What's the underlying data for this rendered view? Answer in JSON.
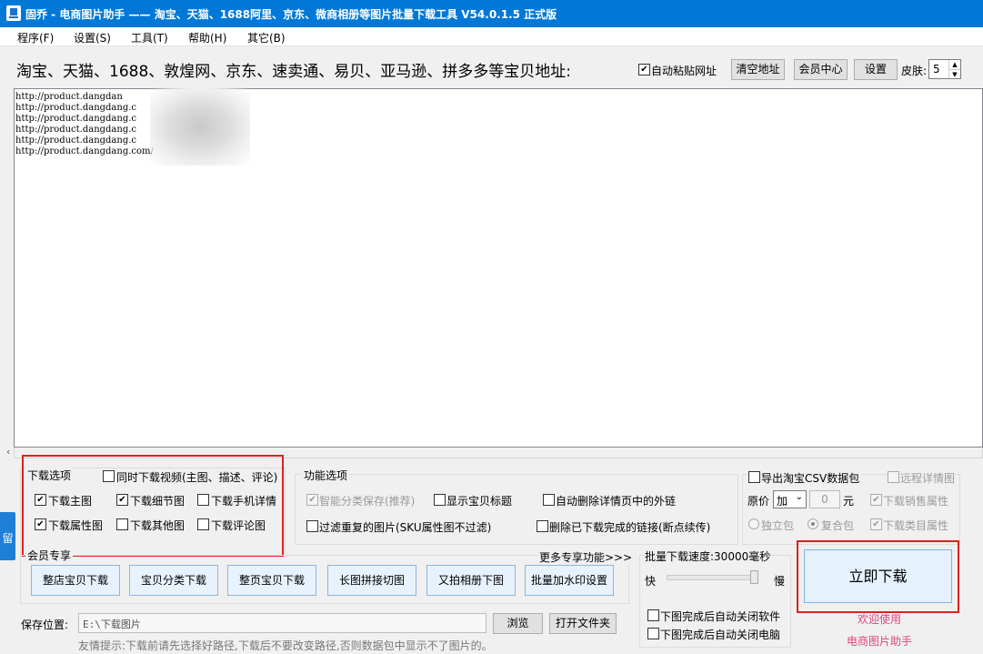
{
  "window": {
    "title": "固乔 - 电商图片助手 —— 淘宝、天猫、1688阿里、京东、微商相册等图片批量下载工具 V54.0.1.5 正式版"
  },
  "menu": [
    "程序(F)",
    "设置(S)",
    "工具(T)",
    "帮助(H)",
    "其它(B)"
  ],
  "toolbar": {
    "url_label": "淘宝、天猫、1688、敦煌网、京东、速卖通、易贝、亚马逊、拼多多等宝贝地址:",
    "auto_paste_label": "自动粘贴网址",
    "auto_paste_checked": true,
    "clear_button": "清空地址",
    "member_button": "会员中心",
    "settings_button": "设置",
    "skin_label": "皮肤:",
    "skin_value": "5"
  },
  "url_list": [
    "http://product.dangdan",
    "http://product.dangdang.c",
    "http://product.dangdang.c",
    "http://product.dangdang.c",
    "http://product.dangdang.c",
    "http://product.dangdang.com/"
  ],
  "left_tab_label": "留",
  "download_options": {
    "title": "下载选项",
    "video_label": "同时下载视频(主图、描述、评论)",
    "video_checked": false,
    "items": [
      {
        "label": "下载主图",
        "checked": true
      },
      {
        "label": "下载细节图",
        "checked": true
      },
      {
        "label": "下载手机详情",
        "checked": false
      },
      {
        "label": "下载属性图",
        "checked": true
      },
      {
        "label": "下载其他图",
        "checked": false
      },
      {
        "label": "下载评论图",
        "checked": false
      }
    ]
  },
  "function_options": {
    "title": "功能选项",
    "items": [
      {
        "label": "智能分类保存(推荐)",
        "checked": true,
        "disabled": true
      },
      {
        "label": "显示宝贝标题",
        "checked": false
      },
      {
        "label": "自动删除详情页中的外链",
        "checked": false
      },
      {
        "label": "过滤重复的图片(SKU属性图不过滤)",
        "checked": false
      },
      {
        "label": "删除已下载完成的链接(断点续传)",
        "checked": false
      }
    ]
  },
  "csv": {
    "export_label": "导出淘宝CSV数据包",
    "export_checked": false,
    "remote_detail_label": "远程详情图",
    "price_label": "原价",
    "price_op": "加",
    "price_value": "0",
    "price_unit": "元",
    "sales_attr_label": "下载销售属性",
    "standalone_label": "独立包",
    "combined_label": "复合包",
    "category_attr_label": "下载类目属性"
  },
  "member": {
    "title": "会员专享",
    "more_link": "更多专享功能>>>",
    "buttons": [
      "整店宝贝下载",
      "宝贝分类下载",
      "整页宝贝下载",
      "长图拼接切图",
      "又拍相册下图",
      "批量加水印设置"
    ]
  },
  "speed": {
    "label": "批量下载速度:30000毫秒",
    "fast": "快",
    "slow": "慢",
    "level": 0.92,
    "close_app_label": "下图完成后自动关闭软件",
    "shutdown_label": "下图完成后自动关闭电脑"
  },
  "download": {
    "button": "立即下载",
    "welcome_1": "欢迎使用",
    "welcome_2": "电商图片助手"
  },
  "save": {
    "label": "保存位置:",
    "path": "E:\\下载图片",
    "browse_button": "浏览",
    "open_folder_button": "打开文件夹",
    "tip": "友情提示:下载前请先选择好路径,下载后不要改变路径,否则数据包中显示不了图片的。"
  },
  "colors": {
    "titlebar": "#0078d7",
    "highlight_box": "#e02020",
    "welcome_text": "#e0447c"
  }
}
